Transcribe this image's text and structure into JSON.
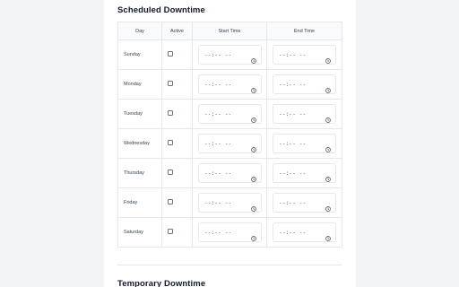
{
  "scheduled": {
    "title": "Scheduled Downtime",
    "headers": {
      "day": "Day",
      "active": "Active",
      "start": "Start Time",
      "end": "End Time"
    },
    "rows": [
      {
        "day": "Sunday",
        "active": false,
        "start": "--:-- --",
        "end": "--:-- --"
      },
      {
        "day": "Monday",
        "active": false,
        "start": "--:-- --",
        "end": "--:-- --"
      },
      {
        "day": "Tuesday",
        "active": false,
        "start": "--:-- --",
        "end": "--:-- --"
      },
      {
        "day": "Wednesday",
        "active": false,
        "start": "--:-- --",
        "end": "--:-- --"
      },
      {
        "day": "Thursday",
        "active": false,
        "start": "--:-- --",
        "end": "--:-- --"
      },
      {
        "day": "Friday",
        "active": false,
        "start": "--:-- --",
        "end": "--:-- --"
      },
      {
        "day": "Saturday",
        "active": false,
        "start": "--:-- --",
        "end": "--:-- --"
      }
    ]
  },
  "temporary": {
    "title": "Temporary Downtime"
  },
  "colors": {
    "page_bg": "#f3f4f6",
    "card_bg": "#ffffff",
    "border": "#e5e7eb",
    "text": "#111827"
  },
  "icons": {
    "time_input": "clock-icon",
    "active": "checkbox"
  }
}
